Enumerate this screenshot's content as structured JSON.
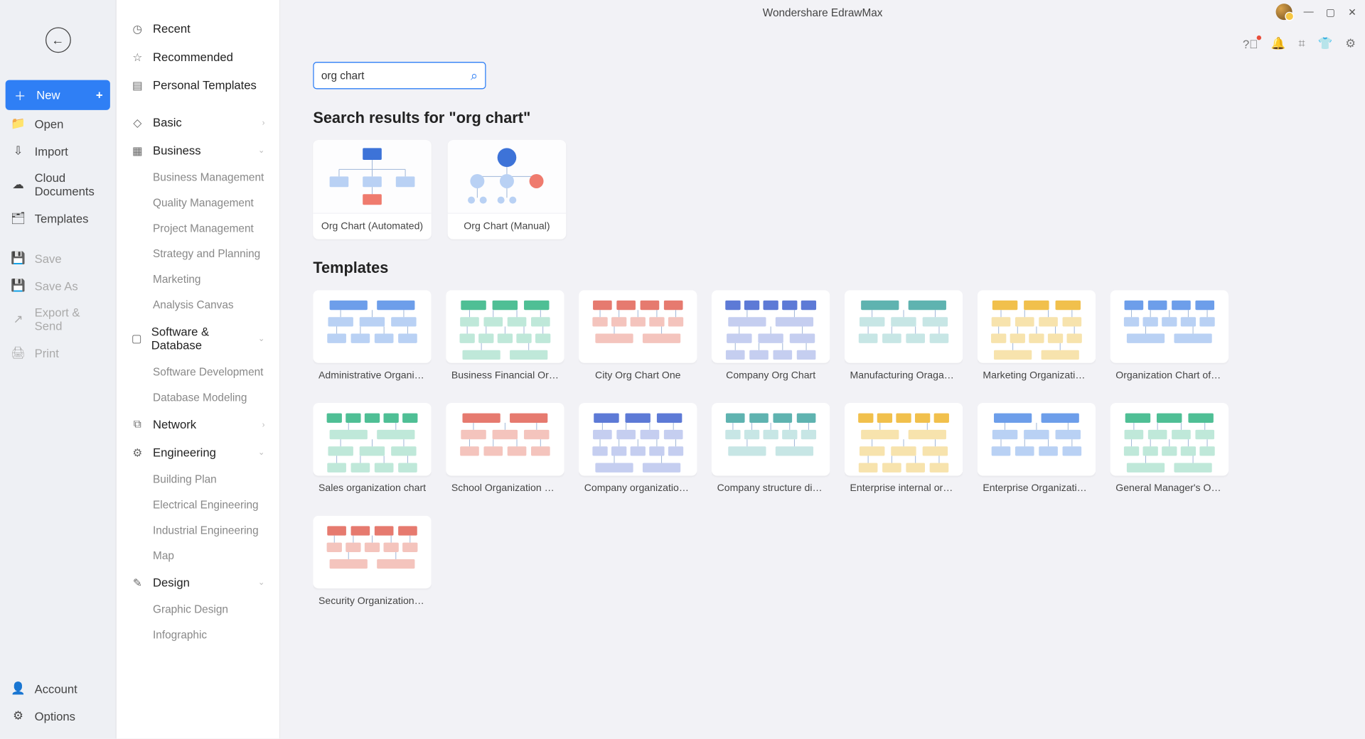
{
  "window": {
    "title": "Wondershare EdrawMax"
  },
  "sidebar": {
    "nav": [
      {
        "label": "New",
        "icon": "＋",
        "active": true,
        "hasPlus": true
      },
      {
        "label": "Open",
        "icon": "📁",
        "active": false
      },
      {
        "label": "Import",
        "icon": "⇩",
        "active": false
      },
      {
        "label": "Cloud Documents",
        "icon": "☁",
        "active": false
      },
      {
        "label": "Templates",
        "icon": "🗂",
        "active": false
      }
    ],
    "navDisabled": [
      {
        "label": "Save",
        "icon": "💾"
      },
      {
        "label": "Save As",
        "icon": "💾"
      },
      {
        "label": "Export & Send",
        "icon": "↗"
      },
      {
        "label": "Print",
        "icon": "🖨"
      }
    ],
    "bottom": [
      {
        "label": "Account",
        "icon": "👤"
      },
      {
        "label": "Options",
        "icon": "⚙"
      }
    ]
  },
  "categories": {
    "quick": [
      {
        "label": "Recent",
        "icon": "◷"
      },
      {
        "label": "Recommended",
        "icon": "☆"
      },
      {
        "label": "Personal Templates",
        "icon": "▤"
      }
    ],
    "groups": [
      {
        "label": "Basic",
        "icon": "◇",
        "chevron": "›",
        "subs": []
      },
      {
        "label": "Business",
        "icon": "▦",
        "chevron": "⌄",
        "subs": [
          "Business Management",
          "Quality Management",
          "Project Management",
          "Strategy and Planning",
          "Marketing",
          "Analysis Canvas"
        ]
      },
      {
        "label": "Software & Database",
        "icon": "▢",
        "chevron": "⌄",
        "subs": [
          "Software Development",
          "Database Modeling"
        ]
      },
      {
        "label": "Network",
        "icon": "⧉",
        "chevron": "›",
        "subs": []
      },
      {
        "label": "Engineering",
        "icon": "⚙",
        "chevron": "⌄",
        "subs": [
          "Building Plan",
          "Electrical Engineering",
          "Industrial Engineering",
          "Map"
        ]
      },
      {
        "label": "Design",
        "icon": "✎",
        "chevron": "⌄",
        "subs": [
          "Graphic Design",
          "Infographic"
        ]
      }
    ]
  },
  "search": {
    "value": "org chart"
  },
  "resultsHeading": "Search results for \"org chart\"",
  "resultCards": [
    {
      "label": "Org Chart (Automated)"
    },
    {
      "label": "Org Chart (Manual)"
    }
  ],
  "templatesHeading": "Templates",
  "templates": [
    {
      "label": "Administrative Organizati..."
    },
    {
      "label": "Business Financial Organiz..."
    },
    {
      "label": "City Org Chart One"
    },
    {
      "label": "Company Org Chart"
    },
    {
      "label": "Manufacturing Oraganizati..."
    },
    {
      "label": "Marketing Organization C..."
    },
    {
      "label": "Organization Chart of Sale..."
    },
    {
      "label": "Sales organization chart"
    },
    {
      "label": "School Organization chart"
    },
    {
      "label": "Company organization chart"
    },
    {
      "label": "Company structure diagram"
    },
    {
      "label": "Enterprise internal organiz..."
    },
    {
      "label": "Enterprise Organization Ch..."
    },
    {
      "label": "General Manager's Office ..."
    },
    {
      "label": "Security Organization Chart"
    }
  ]
}
